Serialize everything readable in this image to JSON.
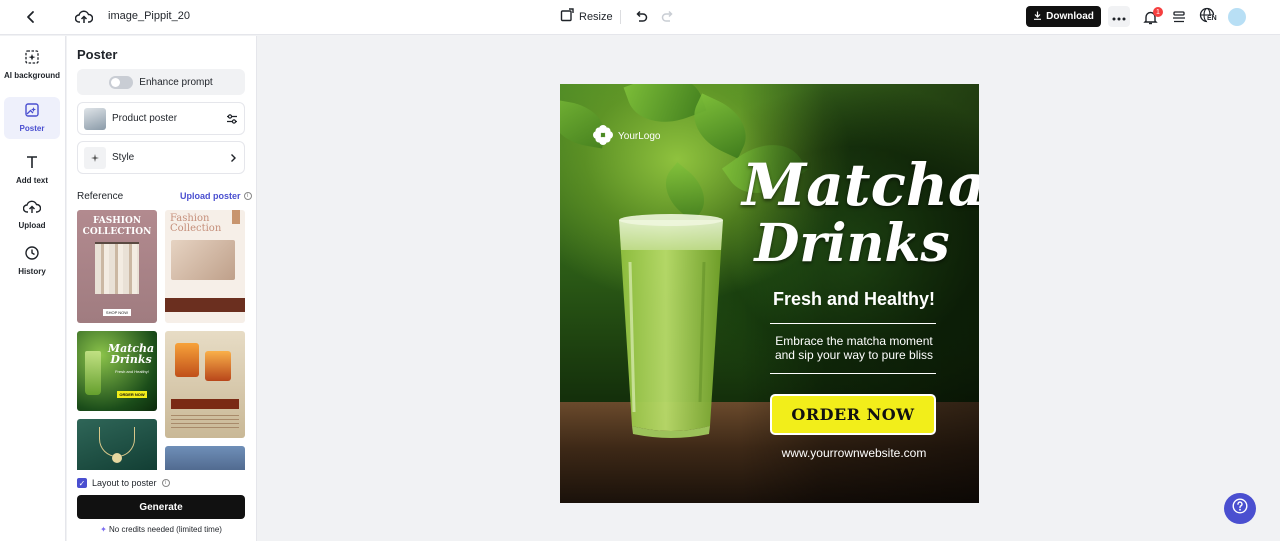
{
  "topbar": {
    "filename": "image_Pippit_20",
    "resize_label": "Resize",
    "download_label": "Download",
    "notification_count": "1",
    "language_label": "EN"
  },
  "rail": {
    "items": [
      {
        "label": "AI background"
      },
      {
        "label": "Poster"
      },
      {
        "label": "Add text"
      },
      {
        "label": "Upload"
      },
      {
        "label": "History"
      }
    ]
  },
  "panel": {
    "title": "Poster",
    "enhance_label": "Enhance prompt",
    "product_label": "Product poster",
    "style_label": "Style",
    "reference_label": "Reference",
    "upload_label": "Upload poster",
    "layout_label": "Layout to poster",
    "generate_label": "Generate",
    "credits_label": "No credits needed (limited time)",
    "cards": {
      "c1_title": "FASHION COLLECTION",
      "c1_button": "SHOP NOW",
      "c2_title": "Fashion Collection",
      "c3_title": "Matcha Drinks",
      "c3_tag": "Fresh and Healthy!",
      "c3_button": "ORDER NOW"
    }
  },
  "poster": {
    "logo_text": "YourLogo",
    "title_line1": "Matcha",
    "title_line2": "Drinks",
    "tagline": "Fresh and Healthy!",
    "subtext_line1": "Embrace the matcha moment",
    "subtext_line2": "and sip your way to pure bliss",
    "order_button": "ORDER NOW",
    "website": "www.yourrownwebsite.com",
    "button_color": "#f2ee1a"
  },
  "colors": {
    "accent": "#4a4fd0",
    "primary_button": "#111111",
    "badge": "#f53f3f"
  }
}
